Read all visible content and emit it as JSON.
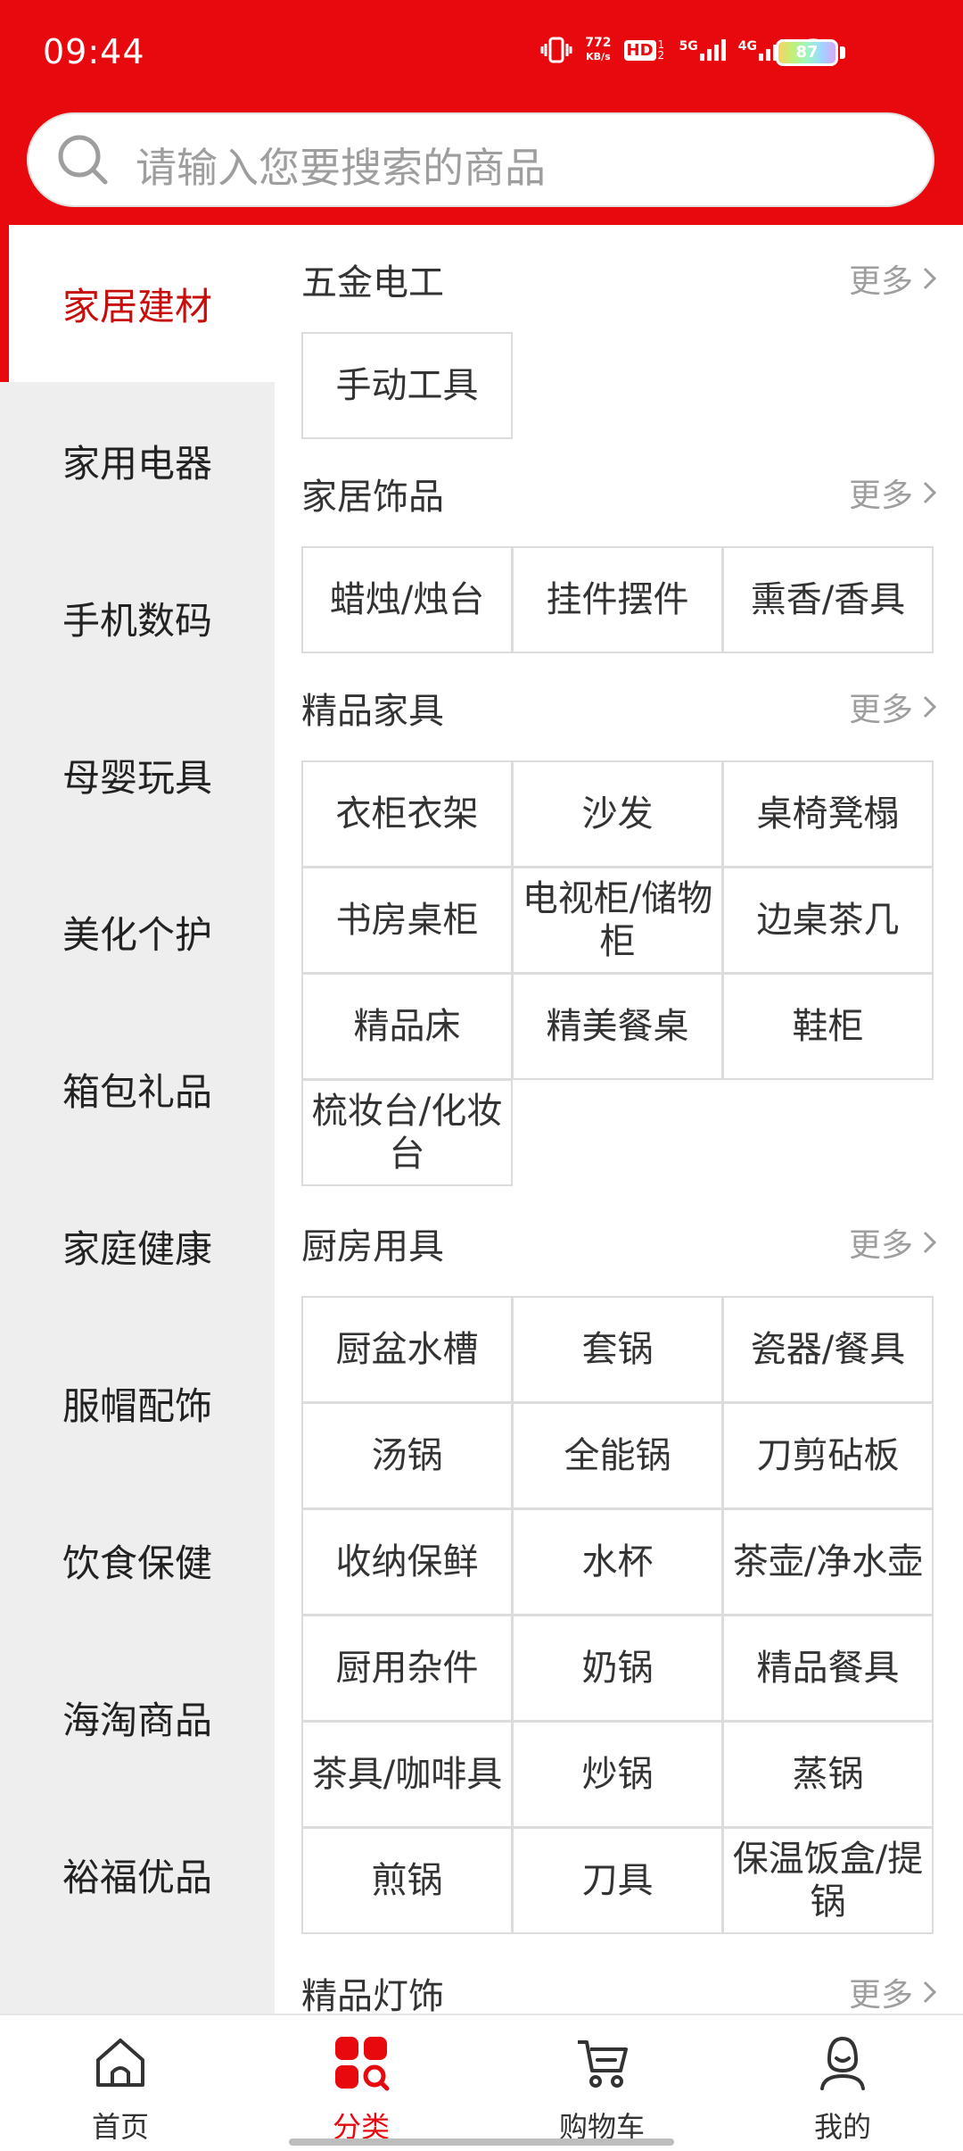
{
  "status_bar": {
    "time": "09:44",
    "net_speed_top": "772",
    "net_speed_unit": "KB/s",
    "hd": "HD",
    "hd_sub": "12",
    "net1": "5G",
    "net2": "4G",
    "battery": "87"
  },
  "search": {
    "placeholder": "请输入您要搜索的商品"
  },
  "sidebar": {
    "items": [
      {
        "label": "家居建材",
        "active": true
      },
      {
        "label": "家用电器"
      },
      {
        "label": "手机数码"
      },
      {
        "label": "母婴玩具"
      },
      {
        "label": "美化个护"
      },
      {
        "label": "箱包礼品"
      },
      {
        "label": "家庭健康"
      },
      {
        "label": "服帽配饰"
      },
      {
        "label": "饮食保健"
      },
      {
        "label": "海淘商品"
      },
      {
        "label": "裕福优品"
      }
    ]
  },
  "more_label": "更多",
  "sections": [
    {
      "title": "五金电工",
      "items": [
        "手动工具"
      ]
    },
    {
      "title": "家居饰品",
      "items": [
        "蜡烛/烛台",
        "挂件摆件",
        "熏香/香具"
      ]
    },
    {
      "title": "精品家具",
      "items": [
        "衣柜衣架",
        "沙发",
        "桌椅凳榻",
        "书房桌柜",
        "电视柜/储物柜",
        "边桌茶几",
        "精品床",
        "精美餐桌",
        "鞋柜",
        "梳妆台/化妆台"
      ]
    },
    {
      "title": "厨房用具",
      "items": [
        "厨盆水槽",
        "套锅",
        "瓷器/餐具",
        "汤锅",
        "全能锅",
        "刀剪砧板",
        "收纳保鲜",
        "水杯",
        "茶壶/净水壶",
        "厨用杂件",
        "奶锅",
        "精品餐具",
        "茶具/咖啡具",
        "炒锅",
        "蒸锅",
        "煎锅",
        "刀具",
        "保温饭盒/提锅"
      ]
    },
    {
      "title": "精品灯饰",
      "items": []
    }
  ],
  "bottom_nav": [
    {
      "label": "首页",
      "icon": "home-icon"
    },
    {
      "label": "分类",
      "icon": "category-icon",
      "active": true
    },
    {
      "label": "购物车",
      "icon": "cart-icon"
    },
    {
      "label": "我的",
      "icon": "profile-icon"
    }
  ],
  "colors": {
    "brand": "#e8090f",
    "active_text": "#c80d0d",
    "sidebar_bg": "#eeeeee"
  }
}
